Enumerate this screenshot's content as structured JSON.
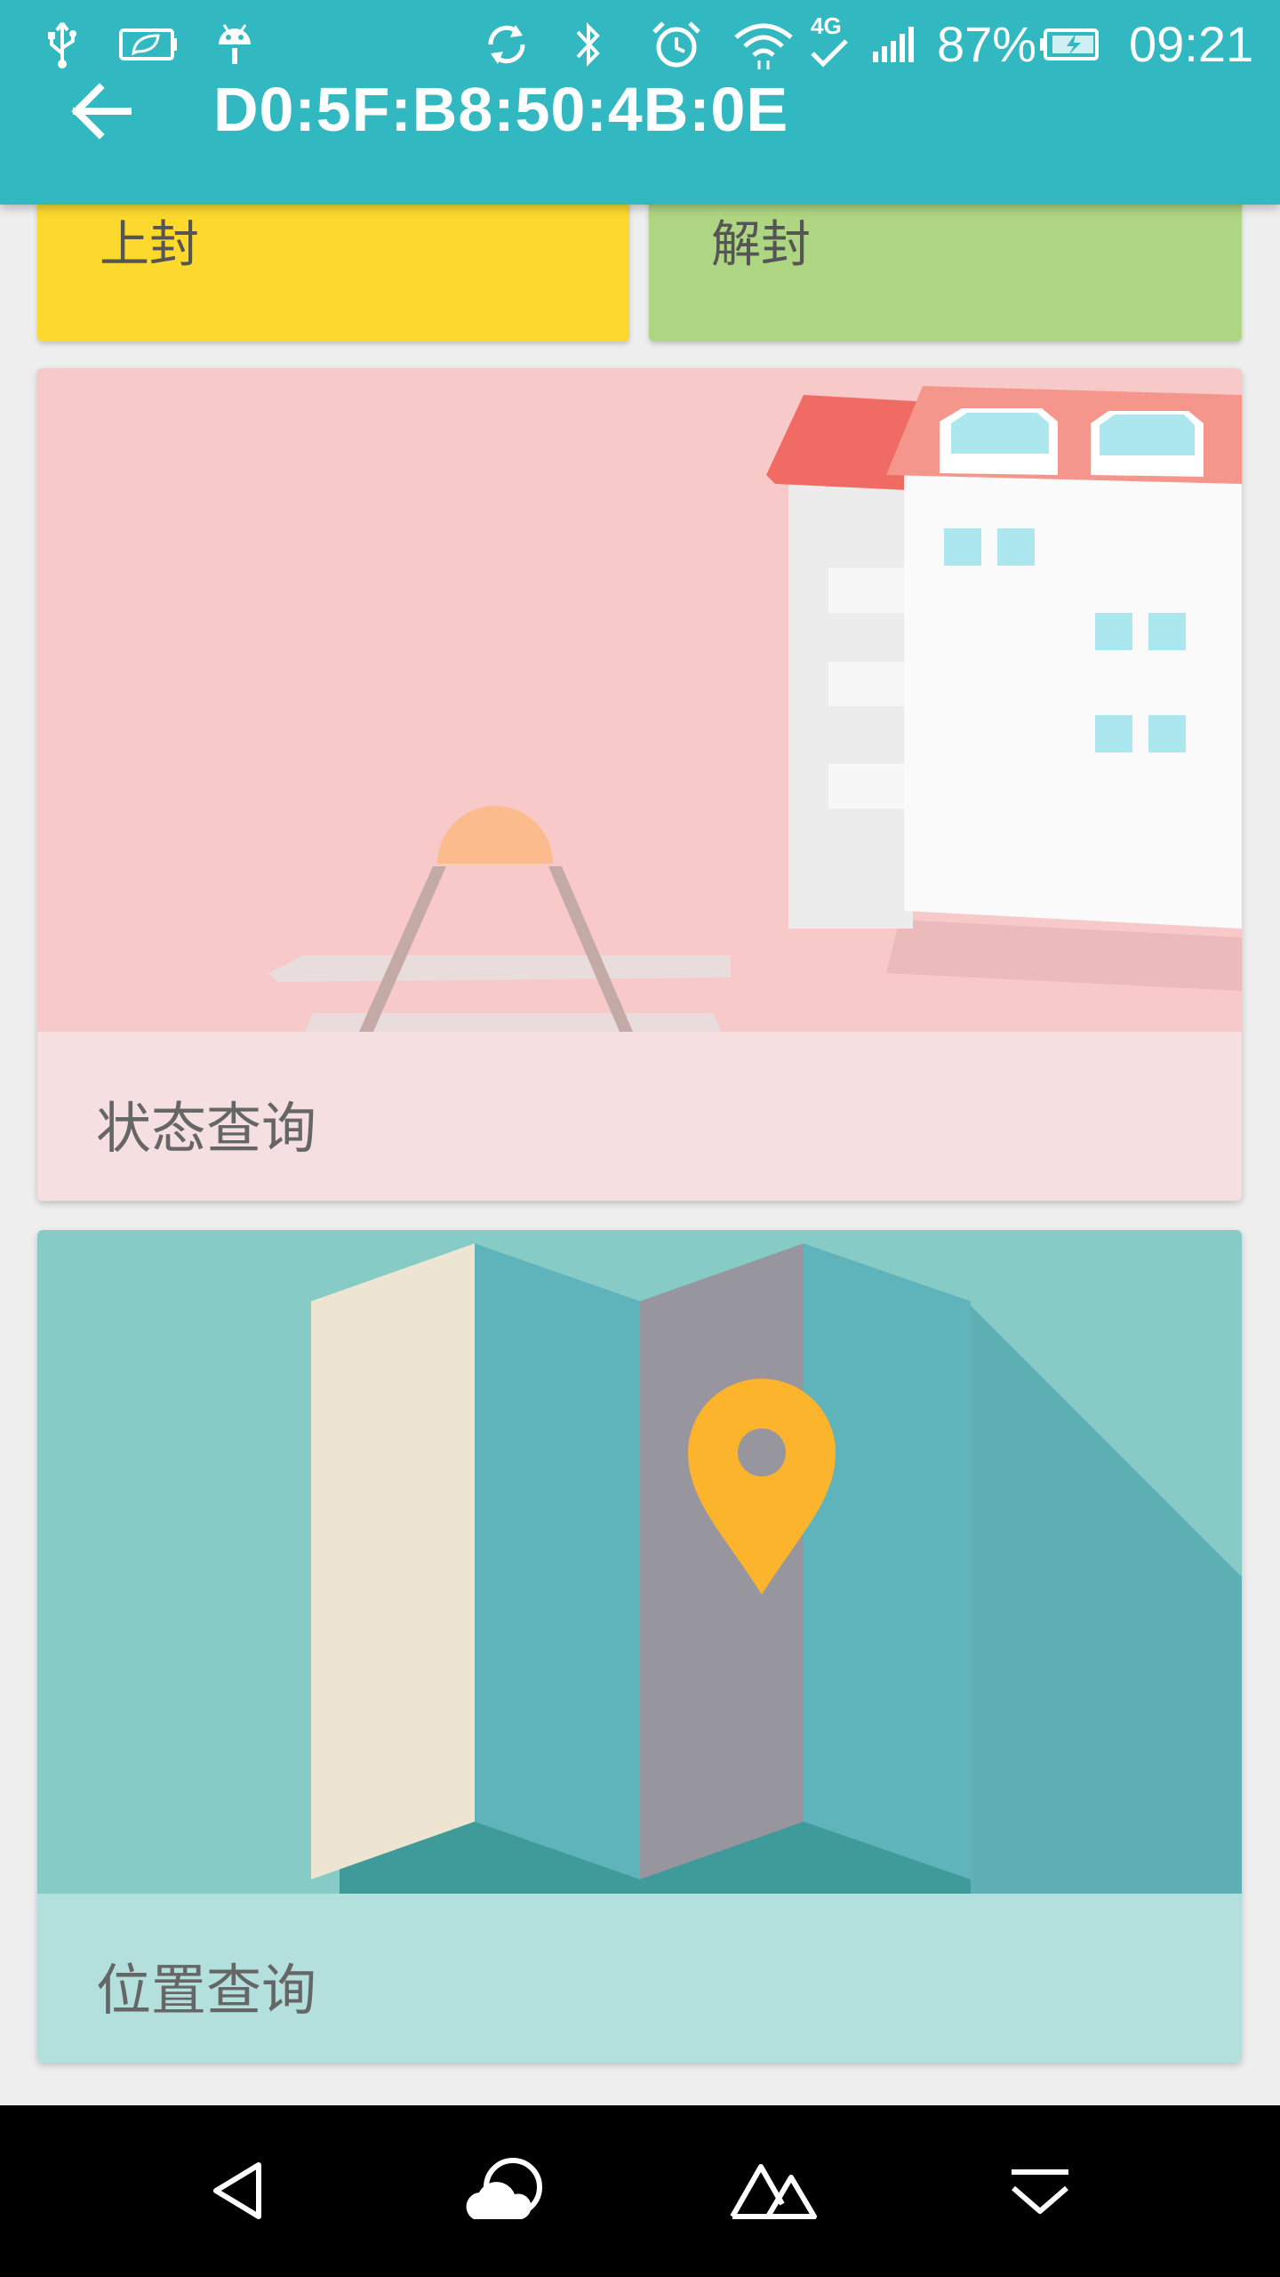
{
  "status_bar": {
    "battery_percent": "87%",
    "time": "09:21",
    "network_label": "4G",
    "icons": [
      "usb-icon",
      "battery-saver-icon",
      "android-debug-icon",
      "sync-icon",
      "bluetooth-icon",
      "alarm-icon",
      "wifi-icon",
      "network-4g-icon",
      "signal-icon",
      "battery-charging-icon"
    ]
  },
  "toolbar": {
    "title": "D0:5F:B8:50:4B:0E",
    "back_icon": "arrow-left-icon"
  },
  "actions": {
    "seal_label": "上封",
    "unseal_label": "解封"
  },
  "cards": [
    {
      "label": "状态查询",
      "art": "building-illustration"
    },
    {
      "label": "位置查询",
      "art": "map-pin-illustration"
    }
  ],
  "colors": {
    "appbar": "#32b8c1",
    "seal": "#fdd92e",
    "unseal": "#aed581",
    "status_card_bg": "#f7c9c9",
    "status_card_footer": "#f5dfe1",
    "location_card_bg": "#86cbc5",
    "location_card_footer": "#b3dfdc",
    "pin": "#fbb42c"
  },
  "nav_bar": {
    "icons": [
      "back-triangle-icon",
      "weather-cloud-icon",
      "mountain-icon",
      "notification-shade-icon"
    ]
  }
}
